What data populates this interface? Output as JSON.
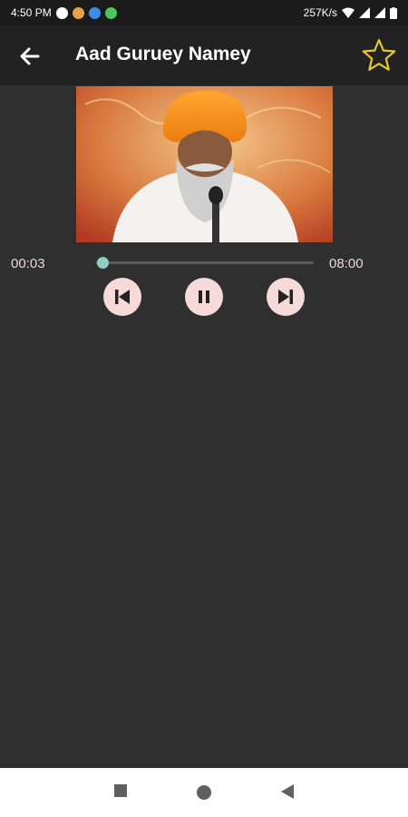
{
  "status_bar": {
    "time": "4:50 PM",
    "network_speed": "257K/s",
    "icons": [
      "app-notification-icon",
      "app-notification-icon",
      "app-notification-icon",
      "check-circle-icon",
      "wifi-icon",
      "signal-icon",
      "signal-icon",
      "battery-icon"
    ]
  },
  "toolbar": {
    "title": "Aad Guruey Namey",
    "back_icon": "arrow-back-icon",
    "favorite_icon": "star-outline-icon"
  },
  "player": {
    "current_time": "00:03",
    "total_time": "08:00",
    "progress": 0.00625,
    "controls": [
      "previous-track-icon",
      "pause-icon",
      "next-track-icon"
    ]
  },
  "navigation_bar": {
    "buttons": [
      "recents-square-icon",
      "home-circle-icon",
      "back-triangle-icon"
    ]
  },
  "colors": {
    "background": "#2f2f2f",
    "toolbar": "#222222",
    "control_button": "#f6d9d9",
    "seek_thumb": "#8ccfc7",
    "time_text": "#f0d6d6",
    "star": "#e6c72a"
  }
}
